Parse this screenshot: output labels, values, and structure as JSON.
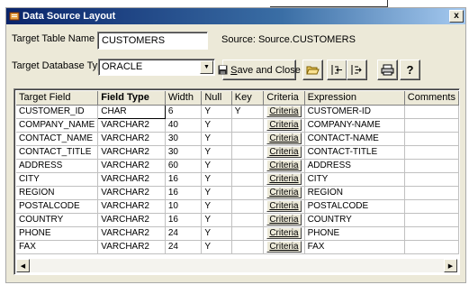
{
  "window": {
    "title": "Data Source Layout",
    "close_label": "x"
  },
  "form": {
    "target_table_label": "Target Table Name",
    "target_table_value": "CUSTOMERS",
    "source_label": "Source: Source.CUSTOMERS",
    "target_db_label": "Target Database Type",
    "target_db_value": "ORACLE"
  },
  "toolbar": {
    "save_close_label": "Save and Close",
    "save_close_underline": "S",
    "save_close_rest": "ave and Close"
  },
  "grid": {
    "columns": [
      "Target Field",
      "Field Type",
      "Width",
      "Null",
      "Key",
      "Criteria",
      "Expression",
      "Comments"
    ],
    "criteria_label": "Criteria",
    "rows": [
      {
        "field": "CUSTOMER_ID",
        "type": "CHAR",
        "width": "6",
        "null": "Y",
        "key": "Y",
        "expr": "CUSTOMER-ID"
      },
      {
        "field": "COMPANY_NAME",
        "type": "VARCHAR2",
        "width": "40",
        "null": "Y",
        "key": "",
        "expr": "COMPANY-NAME"
      },
      {
        "field": "CONTACT_NAME",
        "type": "VARCHAR2",
        "width": "30",
        "null": "Y",
        "key": "",
        "expr": "CONTACT-NAME"
      },
      {
        "field": "CONTACT_TITLE",
        "type": "VARCHAR2",
        "width": "30",
        "null": "Y",
        "key": "",
        "expr": "CONTACT-TITLE"
      },
      {
        "field": "ADDRESS",
        "type": "VARCHAR2",
        "width": "60",
        "null": "Y",
        "key": "",
        "expr": "ADDRESS"
      },
      {
        "field": "CITY",
        "type": "VARCHAR2",
        "width": "16",
        "null": "Y",
        "key": "",
        "expr": "CITY"
      },
      {
        "field": "REGION",
        "type": "VARCHAR2",
        "width": "16",
        "null": "Y",
        "key": "",
        "expr": "REGION"
      },
      {
        "field": "POSTALCODE",
        "type": "VARCHAR2",
        "width": "10",
        "null": "Y",
        "key": "",
        "expr": "POSTALCODE"
      },
      {
        "field": "COUNTRY",
        "type": "VARCHAR2",
        "width": "16",
        "null": "Y",
        "key": "",
        "expr": "COUNTRY"
      },
      {
        "field": "PHONE",
        "type": "VARCHAR2",
        "width": "24",
        "null": "Y",
        "key": "",
        "expr": "PHONE"
      },
      {
        "field": "FAX",
        "type": "VARCHAR2",
        "width": "24",
        "null": "Y",
        "key": "",
        "expr": "FAX"
      }
    ]
  },
  "icons": {
    "title_icon": "app-icon",
    "save_icon": "floppy-disk-icon",
    "open_icon": "folder-open-icon",
    "indent_left_icon": "move-left-icon",
    "indent_right_icon": "move-right-icon",
    "print_icon": "printer-icon",
    "help_icon": "question-mark-icon"
  },
  "colors": {
    "titlebar_start": "#0a246a",
    "titlebar_end": "#a6caf0",
    "dialog_bg": "#ece9d8"
  }
}
